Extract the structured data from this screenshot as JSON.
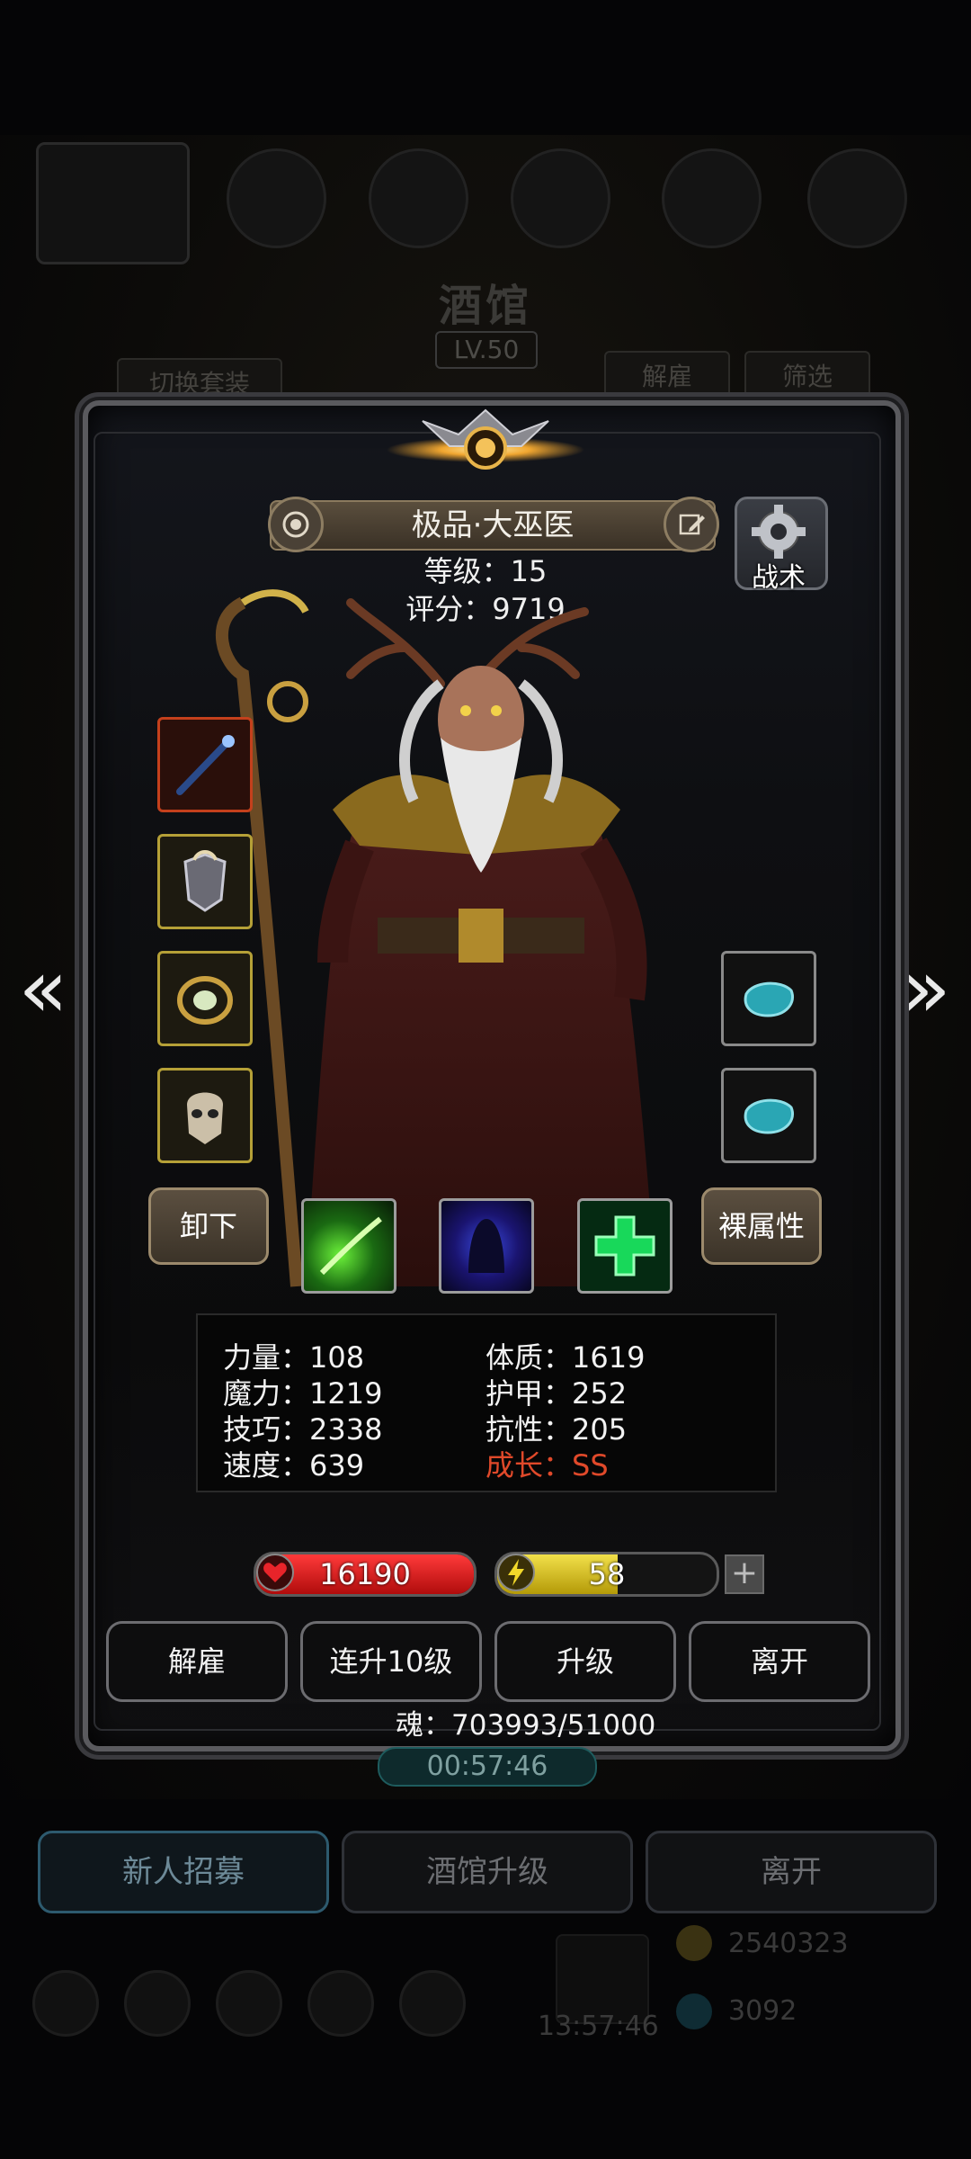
{
  "background": {
    "tavern_title": "酒馆",
    "tavern_level": "LV.50",
    "switch_outfit": "切换套装",
    "dismiss": "解雇",
    "filter": "筛选",
    "timer": "00:57:46",
    "bottom_timer": "13:57:46",
    "gold": "2540323",
    "gems": "3092"
  },
  "hero": {
    "name": "极品·大巫医",
    "level_line": "等级：15",
    "score_line": "评分：9719",
    "tactics_label": "战术"
  },
  "actions": {
    "unequip": "卸下",
    "base_attributes": "裸属性"
  },
  "stats": {
    "strength": "力量：108",
    "magic": "魔力：1219",
    "skill": "技巧：2338",
    "speed": "速度：639",
    "constitution": "体质：1619",
    "armor": "护甲：252",
    "resistance": "抗性：205",
    "growth": "成长：SS"
  },
  "bars": {
    "hp": "16190",
    "energy": "58",
    "energy_fill_percent": 55
  },
  "buttons": {
    "dismiss": "解雇",
    "level_up_10": "连升10级",
    "level_up": "升级",
    "leave": "离开"
  },
  "soul": "魂：703993/51000",
  "bottom_tabs": {
    "recruit": "新人招募",
    "tavern_upgrade": "酒馆升级",
    "leave": "离开"
  },
  "colors": {
    "accent_gold": "#b5a037",
    "hp_red": "#d01b1b",
    "energy_yellow": "#d8c21a",
    "growth_red": "#e0492a"
  }
}
